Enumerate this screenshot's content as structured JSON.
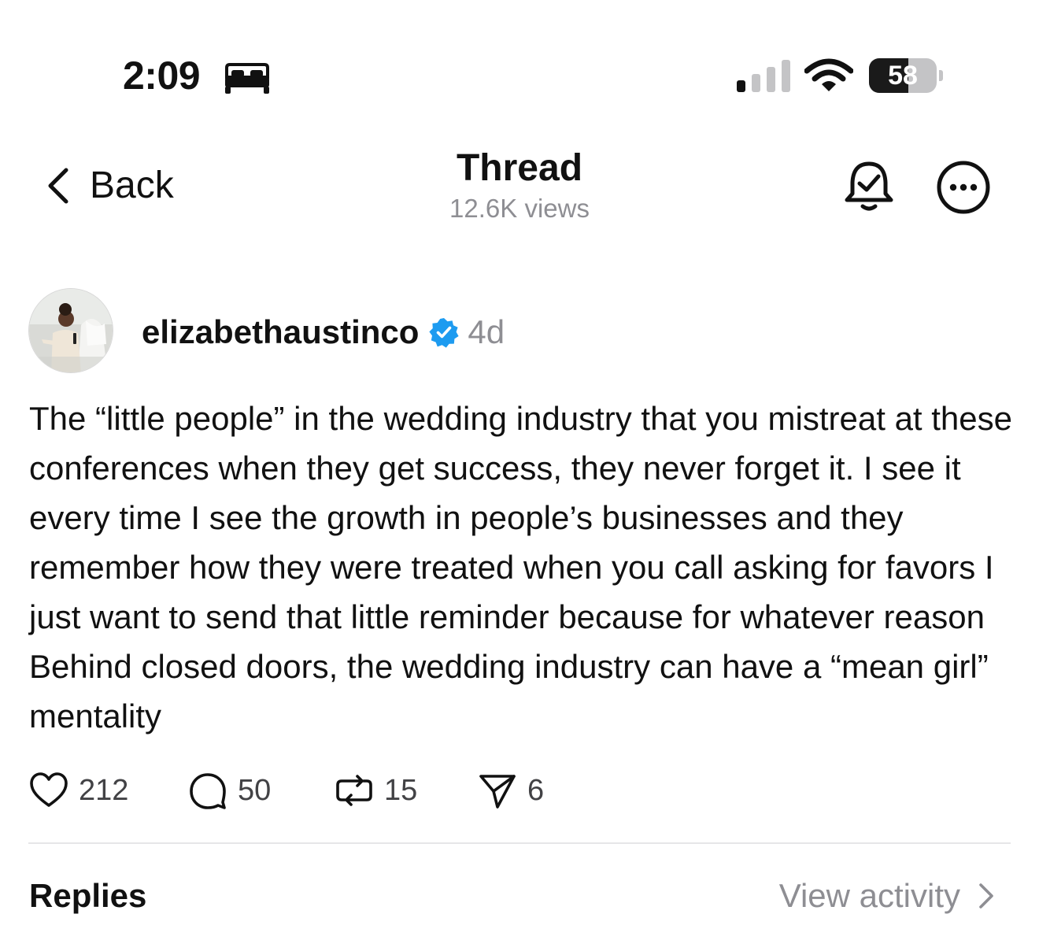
{
  "status_bar": {
    "time": "2:09",
    "battery": "58",
    "battery_level": 0.58,
    "icons": [
      "bed-icon",
      "cellular-signal-icon",
      "wifi-icon",
      "battery-icon"
    ]
  },
  "nav": {
    "back_label": "Back",
    "title": "Thread",
    "subtitle": "12.6K views",
    "icons": [
      "chevron-left-icon",
      "bell-check-icon",
      "more-icon"
    ]
  },
  "post": {
    "username": "elizabethaustinco",
    "age": "4d",
    "verified": true,
    "text": "The “little people” in the wedding industry that you mistreat at these conferences when they get success, they never forget it. I see it every time I see the growth in people’s businesses and they remember how they were treated when you call asking for favors I just want to send that little reminder because for whatever reason Behind closed doors, the wedding industry can have a “mean girl” mentality",
    "actions": {
      "likes": "212",
      "replies": "50",
      "reposts": "15",
      "shares": "6"
    }
  },
  "footer": {
    "replies_label": "Replies",
    "view_activity_label": "View activity"
  },
  "colors": {
    "text": "#111111",
    "muted": "#8e8e93",
    "verified": "#1d9bf0",
    "divider": "#e6e6e8"
  }
}
